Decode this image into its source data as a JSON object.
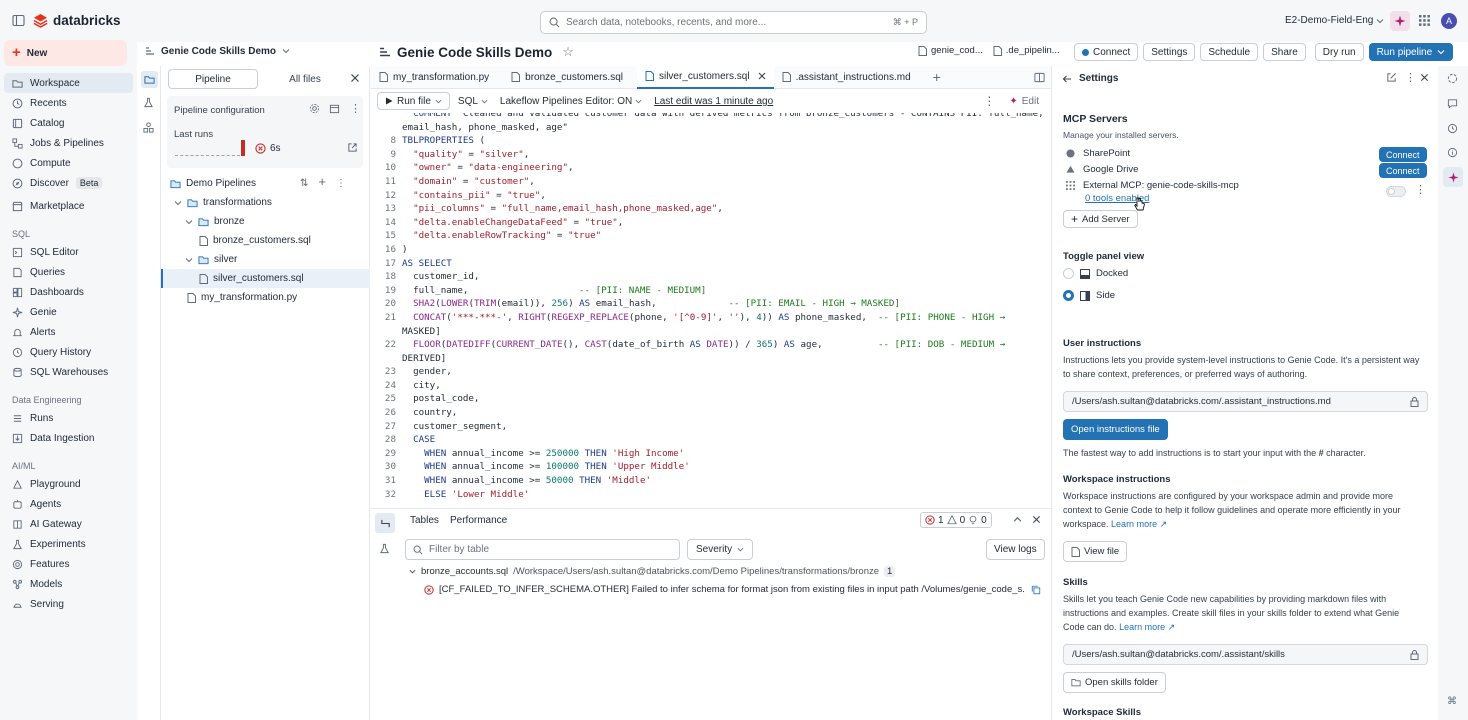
{
  "topbar": {
    "brand": "databricks",
    "search_placeholder": "Search data, notebooks, recents, and more...",
    "search_shortcut": "⌘ + P",
    "workspace": "E2-Demo-Field-Eng",
    "avatar": "A"
  },
  "leftnav": {
    "new_label": "New",
    "items": [
      "Workspace",
      "Recents",
      "Catalog",
      "Jobs & Pipelines",
      "Compute",
      "Discover",
      "Marketplace"
    ],
    "discover_badge": "Beta",
    "sql_section": "SQL",
    "sql_items": [
      "SQL Editor",
      "Queries",
      "Dashboards",
      "Genie",
      "Alerts",
      "Query History",
      "SQL Warehouses"
    ],
    "de_section": "Data Engineering",
    "de_items": [
      "Runs",
      "Data Ingestion"
    ],
    "aiml_section": "AI/ML",
    "aiml_items": [
      "Playground",
      "Agents",
      "AI Gateway",
      "Experiments",
      "Features",
      "Models",
      "Serving"
    ]
  },
  "header": {
    "breadcrumb": "Genie Code Skills Demo",
    "title": "Genie Code Skills Demo",
    "file1": "genie_cod...",
    "file2": ".de_pipelin...",
    "connect": "Connect",
    "settings": "Settings",
    "schedule": "Schedule",
    "share": "Share",
    "dry_run": "Dry run",
    "run_pipeline": "Run pipeline"
  },
  "pipeline": {
    "tab_pipeline": "Pipeline",
    "tab_all_files": "All files",
    "config": "Pipeline configuration",
    "last_runs": "Last runs",
    "run_time": "6s",
    "root": "Demo Pipelines",
    "tree": [
      "transformations",
      "bronze",
      "bronze_customers.sql",
      "silver",
      "silver_customers.sql",
      "my_transformation.py"
    ]
  },
  "editor": {
    "tabs": [
      "my_transformation.py",
      "bronze_customers.sql",
      "silver_customers.sql",
      ".assistant_instructions.md"
    ],
    "run_file": "Run file",
    "lang": "SQL",
    "editor_mode": "Lakeflow Pipelines Editor: ON",
    "last_edit": "Last edit was 1 minute ago",
    "edit": "Edit"
  },
  "code": [
    {
      "n": "",
      "t": "  COMMENT \"Cleaned and validated customer data with derived metrics from bronze_customers - CONTAINS PII: full_name,"
    },
    {
      "n": "",
      "t": "email_hash, phone_masked, age\""
    },
    {
      "n": "8",
      "t": "TBLPROPERTIES ("
    },
    {
      "n": "9",
      "t": "  \"quality\" = \"silver\","
    },
    {
      "n": "10",
      "t": "  \"owner\" = \"data-engineering\","
    },
    {
      "n": "11",
      "t": "  \"domain\" = \"customer\","
    },
    {
      "n": "12",
      "t": "  \"contains_pii\" = \"true\","
    },
    {
      "n": "13",
      "t": "  \"pii_columns\" = \"full_name,email_hash,phone_masked,age\","
    },
    {
      "n": "14",
      "t": "  \"delta.enableChangeDataFeed\" = \"true\","
    },
    {
      "n": "15",
      "t": "  \"delta.enableRowTracking\" = \"true\""
    },
    {
      "n": "16",
      "t": ")"
    },
    {
      "n": "17",
      "t": "AS SELECT"
    },
    {
      "n": "18",
      "t": "  customer_id,"
    },
    {
      "n": "19",
      "t": "  full_name,                    -- [PII: NAME - MEDIUM]"
    },
    {
      "n": "20",
      "t": "  SHA2(LOWER(TRIM(email)), 256) AS email_hash,             -- [PII: EMAIL - HIGH → MASKED]"
    },
    {
      "n": "21",
      "t": "  CONCAT('***-***-', RIGHT(REGEXP_REPLACE(phone, '[^0-9]', ''), 4)) AS phone_masked,  -- [PII: PHONE - HIGH →"
    },
    {
      "n": "",
      "t": "MASKED]"
    },
    {
      "n": "22",
      "t": "  FLOOR(DATEDIFF(CURRENT_DATE(), CAST(date_of_birth AS DATE)) / 365) AS age,          -- [PII: DOB - MEDIUM →"
    },
    {
      "n": "",
      "t": "DERIVED]"
    },
    {
      "n": "23",
      "t": "  gender,"
    },
    {
      "n": "24",
      "t": "  city,"
    },
    {
      "n": "25",
      "t": "  postal_code,"
    },
    {
      "n": "26",
      "t": "  country,"
    },
    {
      "n": "27",
      "t": "  customer_segment,"
    },
    {
      "n": "28",
      "t": "  CASE"
    },
    {
      "n": "29",
      "t": "    WHEN annual_income >= 250000 THEN 'High Income'"
    },
    {
      "n": "30",
      "t": "    WHEN annual_income >= 100000 THEN 'Upper Middle'"
    },
    {
      "n": "31",
      "t": "    WHEN annual_income >= 50000 THEN 'Middle'"
    },
    {
      "n": "32",
      "t": "    ELSE 'Lower Middle'"
    }
  ],
  "bottom": {
    "tab_tables": "Tables",
    "tab_performance": "Performance",
    "errors": "1",
    "warnings": "0",
    "infos": "0",
    "filter_placeholder": "Filter by table",
    "severity": "Severity",
    "view_logs": "View logs",
    "group_file": "bronze_accounts.sql",
    "group_path": "/Workspace/Users/ash.sultan@databricks.com/Demo Pipelines/transformations/bronze",
    "group_count": "1",
    "error_text": "[CF_FAILED_TO_INFER_SCHEMA.OTHER] Failed to infer schema for format json from existing files in input path /Volumes/genie_code_s..."
  },
  "settings": {
    "title": "Settings",
    "mcp_heading": "MCP Servers",
    "mcp_sub": "Manage your installed servers.",
    "servers": [
      "SharePoint",
      "Google Drive"
    ],
    "connect": "Connect",
    "external_mcp": "External MCP: genie-code-skills-mcp",
    "tools_enabled": "0 tools enabled",
    "add_server": "Add Server",
    "toggle_heading": "Toggle panel view",
    "docked": "Docked",
    "side": "Side",
    "user_instr_heading": "User instructions",
    "user_instr_text": "Instructions lets you provide system-level instructions to Genie Code. It's a persistent way to share context, preferences, or preferred ways of authoring.",
    "user_instr_path": "/Users/ash.sultan@databricks.com/.assistant_instructions.md",
    "open_instr": "Open instructions file",
    "fastest_a": "The fastest way to add instructions is to start your input with the ",
    "fastest_b": "#",
    "fastest_c": " character.",
    "ws_heading": "Workspace instructions",
    "ws_text": "Workspace instructions are configured by your workspace admin and provide more context to Genie Code to help it follow guidelines and operate more efficiently in your workspace.",
    "learn_more": "Learn more",
    "view_file": "View file",
    "skills_heading": "Skills",
    "skills_text": "Skills let you teach Genie Code new capabilities by providing markdown files with instructions and examples. Create skill files in your skills folder to extend what Genie Code can do.",
    "skills_path": "/Users/ash.sultan@databricks.com/.assistant/skills",
    "open_skills": "Open skills folder",
    "ws_skills_heading": "Workspace Skills"
  },
  "colors": {
    "accent": "#2272b4",
    "brand": "#e3341e",
    "error": "#c52d2d"
  }
}
